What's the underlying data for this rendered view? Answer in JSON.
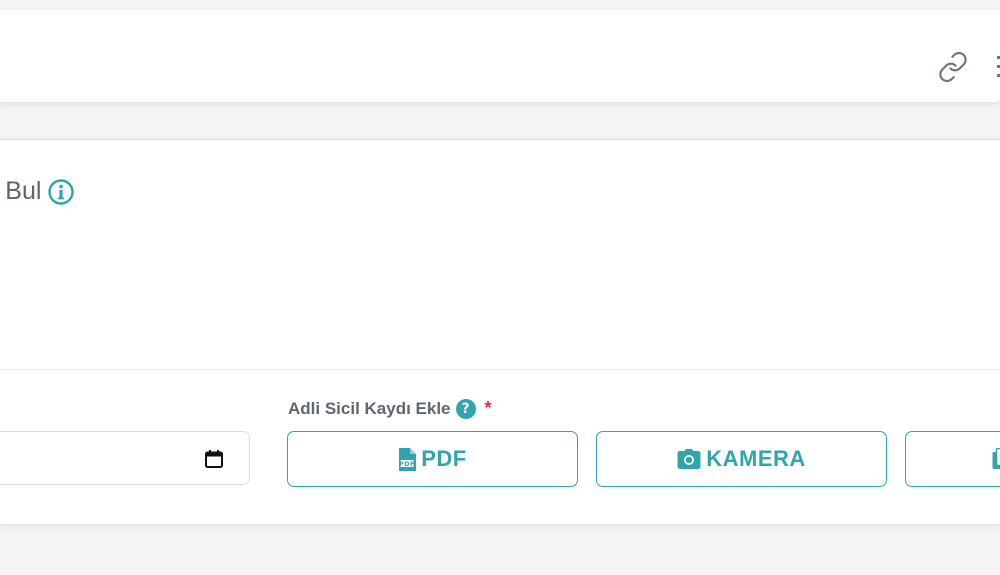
{
  "header": {
    "link_icon": "link-icon",
    "edge_icon": "menu-icon"
  },
  "card": {
    "title": "r Bul",
    "title_icon": "info-icon"
  },
  "date_field": {
    "value": "",
    "icon": "calendar-icon"
  },
  "upload": {
    "label": "Adli Sicil Kaydı Ekle",
    "help_icon_text": "?",
    "required_mark": "*",
    "buttons": [
      {
        "label": "PDF",
        "icon": "pdf-file-icon"
      },
      {
        "label": "KAMERA",
        "icon": "camera-icon"
      },
      {
        "label": "",
        "icon": "file-copy-icon"
      }
    ]
  },
  "colors": {
    "accent": "#2fa5ad",
    "required": "#e8273f",
    "background": "#f4f4f6"
  }
}
